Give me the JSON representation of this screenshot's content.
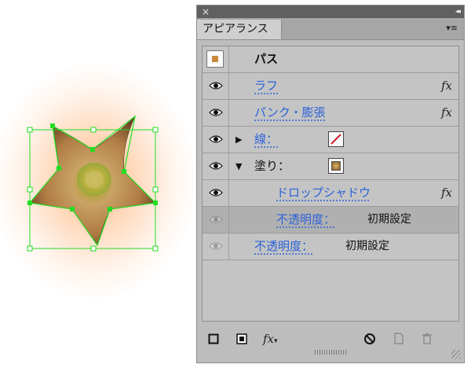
{
  "panel": {
    "title": "アピアランス",
    "close_glyph": "×",
    "collapse_glyph": "◂◂",
    "menu_glyph": "▾≡"
  },
  "rows": [
    {
      "label": "パス",
      "type": "header",
      "icon": "path-thumbnail"
    },
    {
      "label": "ラフ",
      "type": "effect",
      "fx": "fx"
    },
    {
      "label": "パンク・膨張",
      "type": "effect",
      "fx": "fx"
    },
    {
      "label": "線：",
      "type": "stroke",
      "expand": "▶",
      "swatch": "no-stroke"
    },
    {
      "label": "塗り：",
      "type": "fill",
      "expand": "▼",
      "swatch": "gradient-fill"
    },
    {
      "label": "ドロップシャドウ",
      "type": "effect",
      "fx": "fx"
    },
    {
      "label": "不透明度：",
      "value": "初期設定",
      "type": "opacity",
      "selected": true
    },
    {
      "label": "不透明度：",
      "value": "初期設定",
      "type": "opacity"
    }
  ],
  "bottom": {
    "fx_label": "fx",
    "fx_arrow": "▾"
  },
  "colors": {
    "link": "#2b62d9",
    "selection_green": "#22dd22",
    "star_fill": "#b98a4a",
    "glow": "#ffb070"
  }
}
